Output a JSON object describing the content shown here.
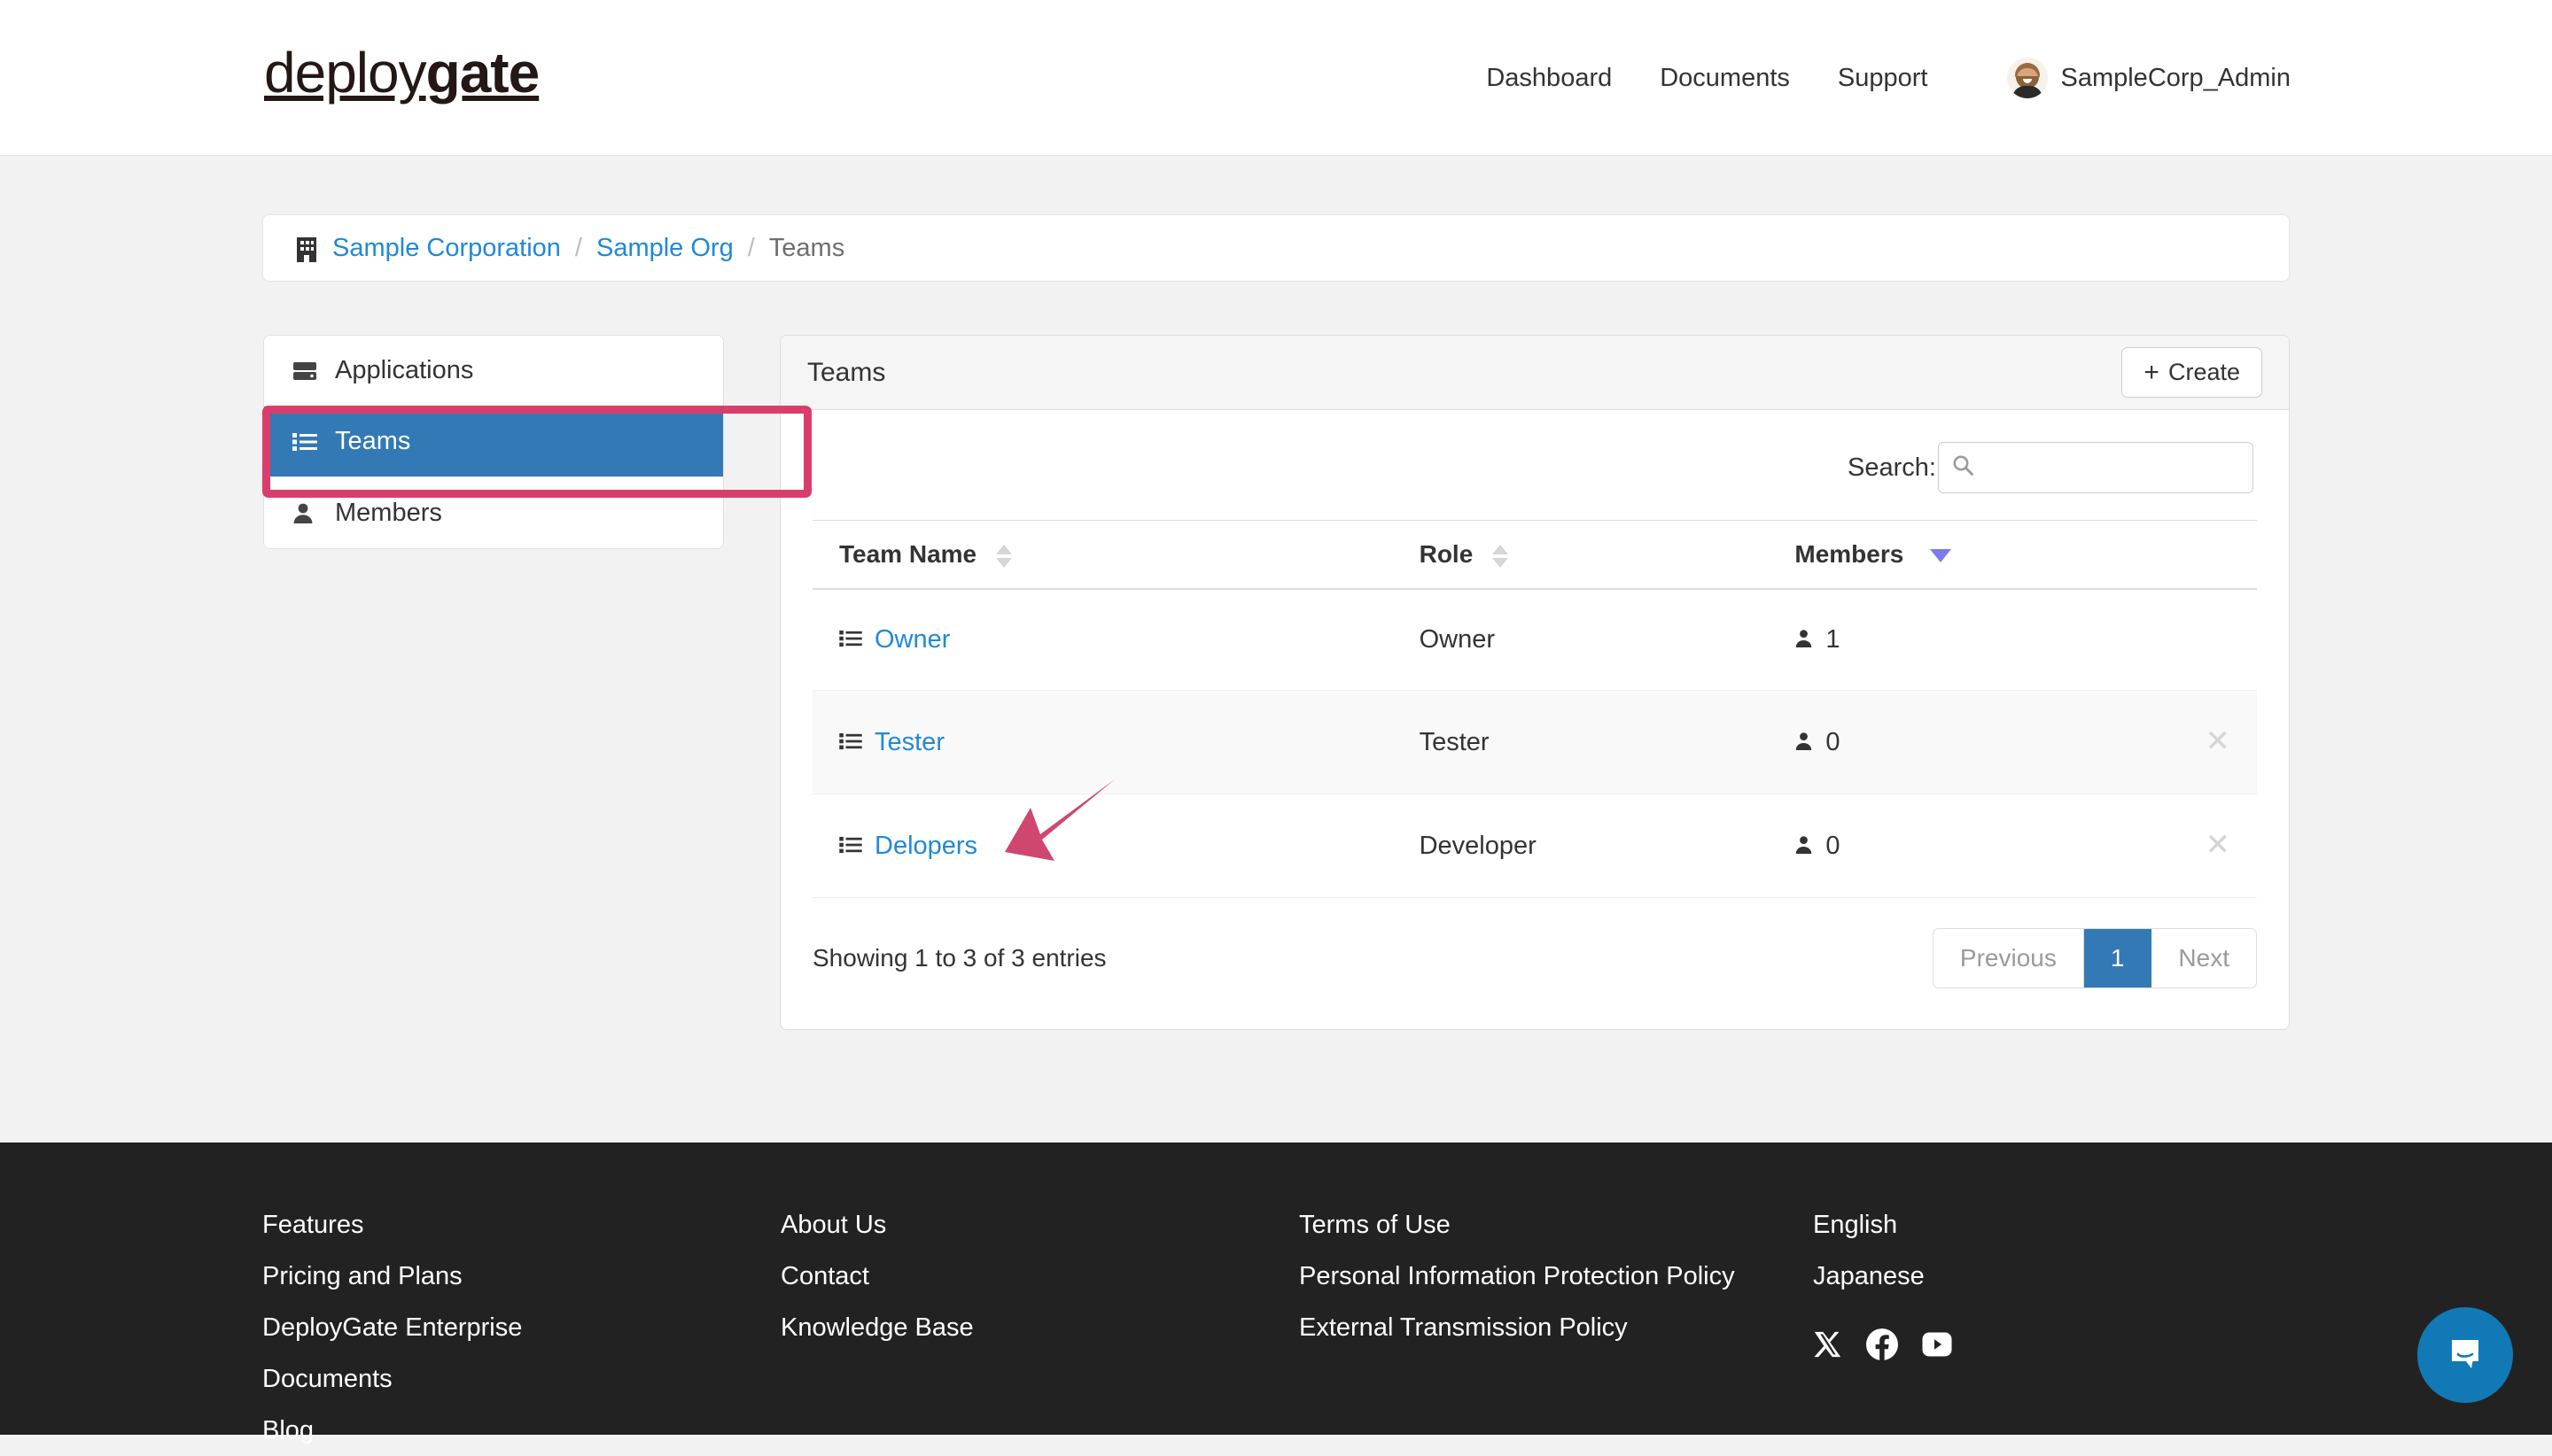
{
  "header": {
    "logo_light": "deploy",
    "logo_bold": "gate",
    "nav": [
      {
        "label": "Dashboard",
        "name": "nav-dashboard"
      },
      {
        "label": "Documents",
        "name": "nav-documents"
      },
      {
        "label": "Support",
        "name": "nav-support"
      }
    ],
    "user": {
      "name": "SampleCorp_Admin",
      "avatar_icon": "user-avatar"
    }
  },
  "breadcrumb": {
    "org_icon": "building-icon",
    "items": [
      {
        "label": "Sample Corporation",
        "link": true
      },
      {
        "label": "Sample Org",
        "link": true
      },
      {
        "label": "Teams",
        "link": false
      }
    ],
    "separator": "/"
  },
  "sidebar": {
    "items": [
      {
        "label": "Applications",
        "icon": "server-icon",
        "active": false
      },
      {
        "label": "Teams",
        "icon": "list-icon",
        "active": true
      },
      {
        "label": "Members",
        "icon": "user-icon",
        "active": false
      }
    ]
  },
  "panel": {
    "title": "Teams",
    "create_label": "Create",
    "create_plus": "+"
  },
  "search": {
    "label": "Search:",
    "value": "",
    "placeholder": "",
    "icon": "search-icon"
  },
  "table": {
    "columns": [
      {
        "label": "Team Name",
        "sort": "both"
      },
      {
        "label": "Role",
        "sort": "both"
      },
      {
        "label": "Members",
        "sort": "desc"
      },
      {
        "label": "",
        "sort": "none"
      }
    ],
    "rows": [
      {
        "team": "Owner",
        "role": "Owner",
        "members": "1",
        "removable": false
      },
      {
        "team": "Tester",
        "role": "Tester",
        "members": "0",
        "removable": true
      },
      {
        "team": "Delopers",
        "role": "Developer",
        "members": "0",
        "removable": true
      }
    ],
    "info": "Showing 1 to 3 of 3 entries",
    "pagination": {
      "previous": "Previous",
      "pages": [
        "1"
      ],
      "next": "Next",
      "current": "1"
    }
  },
  "footer": {
    "columns": [
      {
        "links": [
          "Features",
          "Pricing and Plans",
          "DeployGate Enterprise",
          "Documents",
          "Blog"
        ]
      },
      {
        "links": [
          "About Us",
          "Contact",
          "Knowledge Base"
        ]
      },
      {
        "links": [
          "Terms of Use",
          "Personal Information Protection Policy",
          "External Transmission Policy"
        ]
      },
      {
        "links": [
          "English",
          "Japanese"
        ]
      }
    ],
    "socials": [
      {
        "name": "x-twitter-icon"
      },
      {
        "name": "facebook-icon"
      },
      {
        "name": "youtube-icon"
      }
    ]
  },
  "widgets": {
    "intercom_icon": "chat-bubble-icon"
  },
  "annotations": {
    "highlight_target": "Teams",
    "arrow_target": "Delopers",
    "color": "#d93e6a"
  },
  "colors": {
    "primary_blue": "#3379b5",
    "link_blue": "#2089d6",
    "annotation_pink": "#d93e6a",
    "sort_active": "#7b7bef",
    "footer_bg": "#222222",
    "page_bg": "#f2f2f2"
  }
}
